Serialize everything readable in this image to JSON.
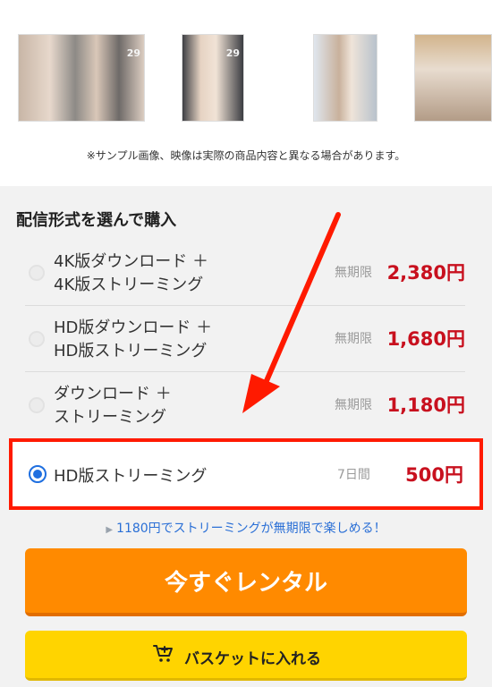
{
  "samples": {
    "thumbnails": [
      {
        "label": "29"
      },
      {
        "label": "29"
      },
      {
        "label": ""
      },
      {
        "label": ""
      }
    ],
    "notice": "※サンプル画像、映像は実際の商品内容と異なる場合があります。"
  },
  "purchase": {
    "title": "配信形式を選んで購入",
    "options": [
      {
        "name_line1": "4K版ダウンロード ＋",
        "name_line2": "4K版ストリーミング",
        "term": "無期限",
        "price": "2,380円",
        "selected": false
      },
      {
        "name_line1": "HD版ダウンロード ＋",
        "name_line2": "HD版ストリーミング",
        "term": "無期限",
        "price": "1,680円",
        "selected": false
      },
      {
        "name_line1": "ダウンロード ＋",
        "name_line2": "ストリーミング",
        "term": "無期限",
        "price": "1,180円",
        "selected": false
      },
      {
        "name_line1": "HD版ストリーミング",
        "name_line2": "",
        "term": "7日間",
        "price": "500円",
        "selected": true
      }
    ],
    "promo": "1180円でストリーミングが無期限で楽しめる！"
  },
  "buttons": {
    "rent_label": "今すぐレンタル",
    "basket_label": "バスケットに入れる"
  },
  "colors": {
    "price": "#c8101e",
    "rent_button": "#ff8a00",
    "basket_button": "#ffd400",
    "highlight": "#ff1a00",
    "radio_selected": "#1f6fe0"
  }
}
